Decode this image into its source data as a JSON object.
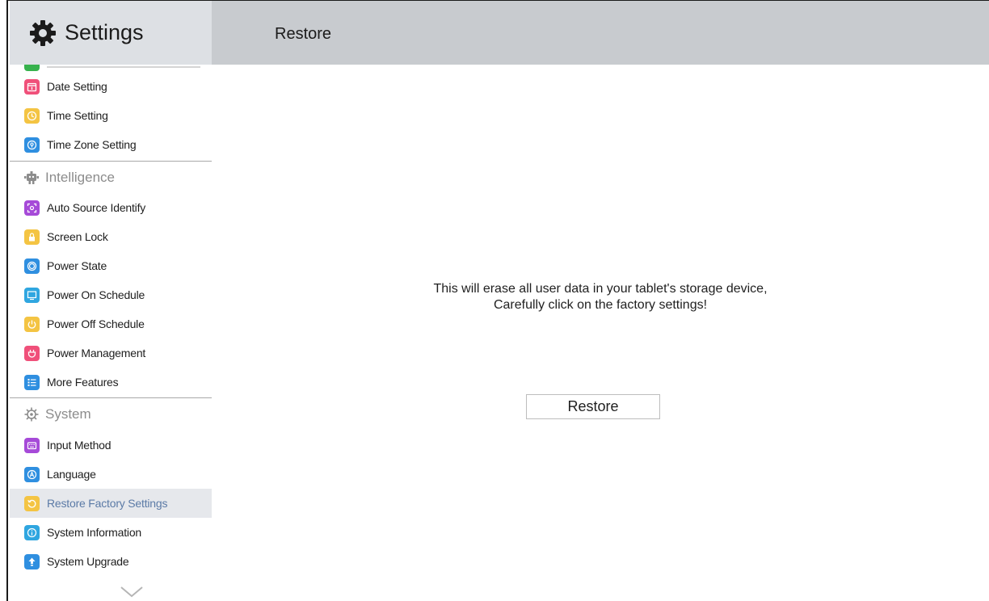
{
  "sidebar": {
    "title": "Settings",
    "items": [
      {
        "key": "date-setting",
        "label": "Date Setting",
        "icon": "calendar-icon",
        "color": "#f0507a"
      },
      {
        "key": "time-setting",
        "label": "Time Setting",
        "icon": "clock-icon",
        "color": "#f4c443"
      },
      {
        "key": "time-zone-setting",
        "label": "Time Zone Setting",
        "icon": "location-pin-icon",
        "color": "#2f8fe0"
      },
      {
        "key": "auto-source-identify",
        "label": "Auto Source Identify",
        "icon": "focus-icon",
        "color": "#a64ad8"
      },
      {
        "key": "screen-lock",
        "label": "Screen Lock",
        "icon": "lock-icon",
        "color": "#f4c443"
      },
      {
        "key": "power-state",
        "label": "Power State",
        "icon": "power-state-icon",
        "color": "#2f8fe0"
      },
      {
        "key": "power-on-schedule",
        "label": "Power On Schedule",
        "icon": "monitor-icon",
        "color": "#2fa6e0"
      },
      {
        "key": "power-off-schedule",
        "label": "Power Off Schedule",
        "icon": "power-icon",
        "color": "#f4c443"
      },
      {
        "key": "power-management",
        "label": "Power Management",
        "icon": "plug-icon",
        "color": "#f0507a"
      },
      {
        "key": "more-features",
        "label": "More Features",
        "icon": "list-icon",
        "color": "#2f8fe0"
      },
      {
        "key": "input-method",
        "label": "Input Method",
        "icon": "keyboard-icon",
        "color": "#a64ad8"
      },
      {
        "key": "language",
        "label": "Language",
        "icon": "language-icon",
        "color": "#2f8fe0"
      },
      {
        "key": "restore-factory-settings",
        "label": "Restore Factory Settings",
        "icon": "restore-icon",
        "color": "#f4c443"
      },
      {
        "key": "system-information",
        "label": "System Information",
        "icon": "info-icon",
        "color": "#2fa6e0"
      },
      {
        "key": "system-upgrade",
        "label": "System Upgrade",
        "icon": "upgrade-icon",
        "color": "#2f8fe0"
      }
    ],
    "sections": {
      "intelligence": "Intelligence",
      "system": "System"
    },
    "active_item": "Restore Factory Settings"
  },
  "header": {
    "title": "Restore"
  },
  "main": {
    "message_line1": "This will erase all user data in your tablet's storage device,",
    "message_line2": "Carefully click on the factory settings!",
    "restore_button_label": "Restore"
  },
  "colors": {
    "sidebar_header_bg": "#dde0e4",
    "topbar_bg": "#c8cbcf",
    "active_item_bg": "#e6e8ec",
    "active_item_text": "#5b7aa6"
  }
}
